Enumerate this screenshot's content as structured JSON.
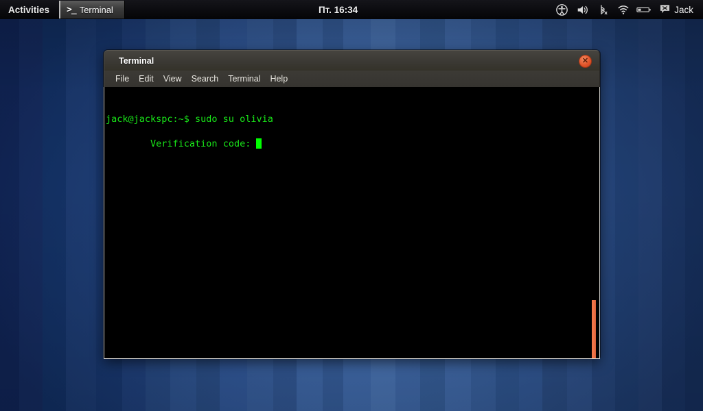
{
  "topbar": {
    "activities_label": "Activities",
    "task_buttons": [
      {
        "icon": "terminal-prompt-icon",
        "glyph": ">_",
        "label": "Terminal"
      }
    ],
    "clock": "Пт. 16:34",
    "tray_icons": [
      {
        "name": "accessibility-icon",
        "title": "Universal Access"
      },
      {
        "name": "volume-icon",
        "title": "Volume"
      },
      {
        "name": "bluetooth-disabled-icon",
        "title": "Bluetooth Off"
      },
      {
        "name": "wifi-icon",
        "title": "Network"
      },
      {
        "name": "battery-icon",
        "title": "Battery"
      }
    ],
    "user": {
      "icon": "message-user-icon",
      "name": "Jack"
    }
  },
  "window": {
    "title": "Terminal",
    "close_label": "✕",
    "menu": [
      {
        "label": "File"
      },
      {
        "label": "Edit"
      },
      {
        "label": "View"
      },
      {
        "label": "Search"
      },
      {
        "label": "Terminal"
      },
      {
        "label": "Help"
      }
    ],
    "terminal": {
      "lines": [
        "jack@jackspc:~$ sudo su olivia",
        "Verification code: "
      ],
      "prompt_line": "jack@jackspc:~$ sudo su olivia",
      "input_line": "Verification code: ",
      "text_color": "#19e619",
      "cursor_color": "#00ff00",
      "background": "#000000"
    },
    "scrollbar": {
      "thumb_color": "#ef7347"
    }
  },
  "colors": {
    "panel_bg": "#0c0c10",
    "titlebar_bg": "#3b3934",
    "close_button": "#e2552a",
    "desktop_blue": "#2d5291"
  }
}
